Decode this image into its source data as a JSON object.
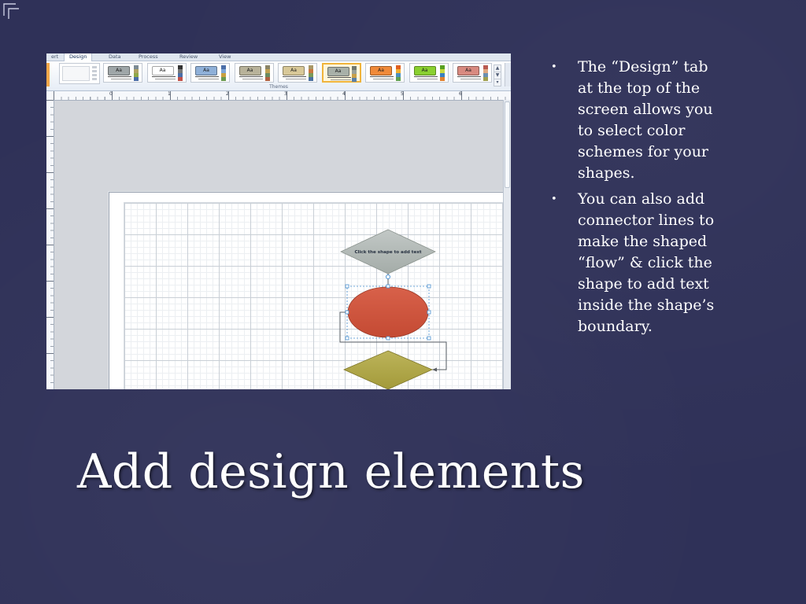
{
  "slide": {
    "title": "Add design elements",
    "bullets": [
      "The “Design” tab at the top of the screen allows you to select color schemes for your shapes.",
      "You can also add connector lines to make the shaped “flow” & click the shape to add text inside the shape’s boundary."
    ],
    "bullet_marker": "•"
  },
  "screenshot": {
    "tabs": [
      {
        "label": "ert",
        "active": false
      },
      {
        "label": "Design",
        "active": true
      },
      {
        "label": "Data",
        "active": false
      },
      {
        "label": "Process",
        "active": false
      },
      {
        "label": "Review",
        "active": false
      },
      {
        "label": "View",
        "active": false
      }
    ],
    "theme_thumbnail_label": "Aa",
    "themes": [
      {
        "swatch": "#9fa6a8",
        "strip": [
          "#7c8a94",
          "#b0a262",
          "#8fa84a",
          "#4b6ea8"
        ],
        "selected": false
      },
      {
        "swatch": "#ffffff",
        "strip": [
          "#333333",
          "#777777",
          "#4b6ea8",
          "#c05048"
        ],
        "selected": false
      },
      {
        "swatch": "#8fb0d8",
        "strip": [
          "#4b6ea8",
          "#7ea6d8",
          "#c8a040",
          "#6a9a50"
        ],
        "selected": false
      },
      {
        "swatch": "#b8b29a",
        "strip": [
          "#8a8466",
          "#c0a050",
          "#6a8a60",
          "#b06040"
        ],
        "selected": false
      },
      {
        "swatch": "#d8c898",
        "strip": [
          "#a89868",
          "#c87840",
          "#7a9a58",
          "#4a70a0"
        ],
        "selected": false
      },
      {
        "swatch": "#a8b0a8",
        "strip": [
          "#707870",
          "#98a098",
          "#c8a048",
          "#5a80a8"
        ],
        "selected": true
      },
      {
        "swatch": "#f08a3a",
        "strip": [
          "#e06020",
          "#f0b030",
          "#4a90c0",
          "#60a050"
        ],
        "selected": false
      },
      {
        "swatch": "#8ad030",
        "strip": [
          "#58a020",
          "#c8d840",
          "#3a80c0",
          "#e08030"
        ],
        "selected": false
      },
      {
        "swatch": "#d88a80",
        "strip": [
          "#b85a50",
          "#e0a880",
          "#6a90b0",
          "#a0a050"
        ],
        "selected": false
      }
    ],
    "gallery_scroll": [
      "▲",
      "▼",
      "▾"
    ],
    "group_label": "Themes",
    "ruler_numbers": [
      "0",
      "1",
      "2",
      "3",
      "4",
      "5",
      "6"
    ],
    "diamond_text": "Click the shape to add text",
    "colors": {
      "diamond_top": "#a4aca8",
      "ellipse": "#c44a33",
      "diamond_bottom": "#a39a3a",
      "selection": "#4a90d0"
    }
  }
}
